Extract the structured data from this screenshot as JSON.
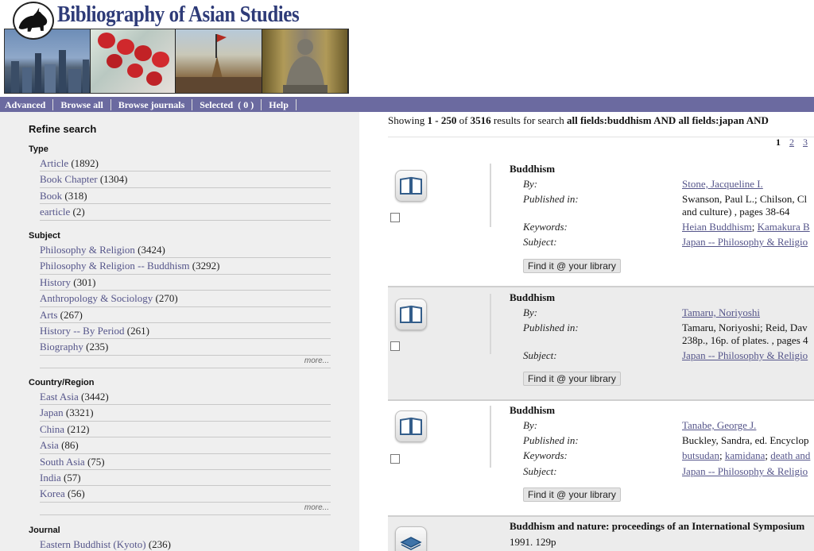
{
  "header": {
    "site_title": "Bibliography of Asian Studies"
  },
  "nav": {
    "items": [
      "Advanced",
      "Browse all",
      "Browse journals",
      "Selected  ( 0 )",
      "Help"
    ]
  },
  "sidebar": {
    "title": "Refine search",
    "more_label": "more...",
    "facets": {
      "type": {
        "title": "Type",
        "items": [
          {
            "label": "Article",
            "count": "(1892)"
          },
          {
            "label": "Book Chapter",
            "count": "(1304)"
          },
          {
            "label": "Book",
            "count": "(318)"
          },
          {
            "label": "earticle",
            "count": "(2)"
          }
        ]
      },
      "subject": {
        "title": "Subject",
        "items": [
          {
            "label": "Philosophy & Religion",
            "count": "(3424)"
          },
          {
            "label": "Philosophy & Religion -- Buddhism",
            "count": "(3292)"
          },
          {
            "label": "History",
            "count": "(301)"
          },
          {
            "label": "Anthropology & Sociology",
            "count": "(270)"
          },
          {
            "label": "Arts",
            "count": "(267)"
          },
          {
            "label": "History -- By Period",
            "count": "(261)"
          },
          {
            "label": "Biography",
            "count": "(235)"
          }
        ]
      },
      "country": {
        "title": "Country/Region",
        "items": [
          {
            "label": "East Asia",
            "count": "(3442)"
          },
          {
            "label": "Japan",
            "count": "(3321)"
          },
          {
            "label": "China",
            "count": "(212)"
          },
          {
            "label": "Asia",
            "count": "(86)"
          },
          {
            "label": "South Asia",
            "count": "(75)"
          },
          {
            "label": "India",
            "count": "(57)"
          },
          {
            "label": "Korea",
            "count": "(56)"
          }
        ]
      },
      "journal": {
        "title": "Journal",
        "items": [
          {
            "label": "Eastern Buddhist (Kyoto)",
            "count": "(236)"
          }
        ]
      }
    }
  },
  "results": {
    "summary": {
      "prefix": "Showing ",
      "range": "1 - 250",
      "of": " of ",
      "total": "3516",
      "mid": " results for search ",
      "query": "all fields:buddhism AND all fields:japan AND"
    },
    "pages": [
      "1",
      "2",
      "3"
    ],
    "find_label": "Find it @ your library",
    "labels": {
      "by": "By:",
      "published": "Published in:",
      "keywords": "Keywords:",
      "subject": "Subject:"
    },
    "records": [
      {
        "title": "Buddhism",
        "by": "Stone, Jacqueline I.",
        "published_line1": "Swanson, Paul L.; Chilson, Cl",
        "published_line2": "and culture) , pages 38-64",
        "keywords": [
          "Heian Buddhism",
          "Kamakura B"
        ],
        "subject": "Japan -- Philosophy & Religio"
      },
      {
        "title": "Buddhism",
        "by": "Tamaru, Noriyoshi",
        "published_line1": "Tamaru, Noriyoshi; Reid, Dav",
        "published_line2": "238p., 16p. of plates. , pages 4",
        "subject": "Japan -- Philosophy & Religio"
      },
      {
        "title": "Buddhism",
        "by": "Tanabe, George J.",
        "published_line1": "Buckley, Sandra, ed. Encyclop",
        "keywords": [
          "butsudan",
          "kamidana",
          "death and"
        ],
        "subject": "Japan -- Philosophy & Religio"
      },
      {
        "title": "Buddhism and nature: proceedings of an International Symposium",
        "sub": "1991. 129p"
      }
    ]
  }
}
